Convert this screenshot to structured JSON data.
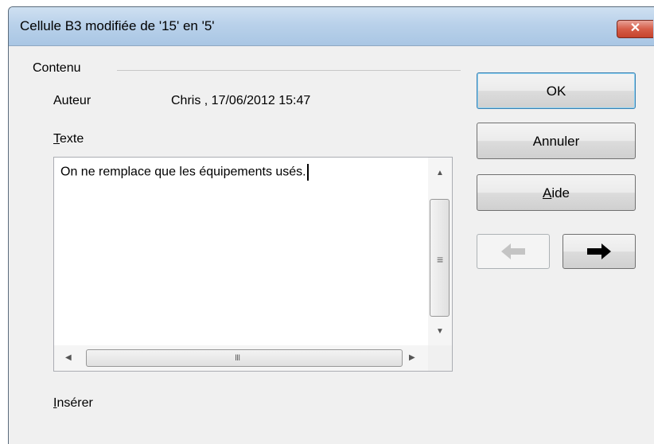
{
  "window": {
    "title": "Cellule B3 modifiée de '15' en '5'",
    "close_glyph": "✕"
  },
  "content": {
    "group_label": "Contenu",
    "author_label": "Auteur",
    "author_value": "Chris , 17/06/2012 15:47",
    "text_label_first": "T",
    "text_label_rest": "exte",
    "text_value": "On ne remplace que les équipements usés.",
    "insert_label_first": "I",
    "insert_label_rest": "nsérer"
  },
  "buttons": {
    "ok": "OK",
    "cancel": "Annuler",
    "help_first": "A",
    "help_rest": "ide",
    "prev_glyph": "🡄",
    "next_glyph": "🡆"
  },
  "scrollbar": {
    "up": "▲",
    "down": "▼",
    "left": "◀",
    "right": "▶",
    "grip_v": "≡",
    "grip_h": "III"
  },
  "colors": {
    "title_bar": "#b9d1ea",
    "close_button": "#d65d48",
    "ok_border": "#3c7fb1"
  }
}
